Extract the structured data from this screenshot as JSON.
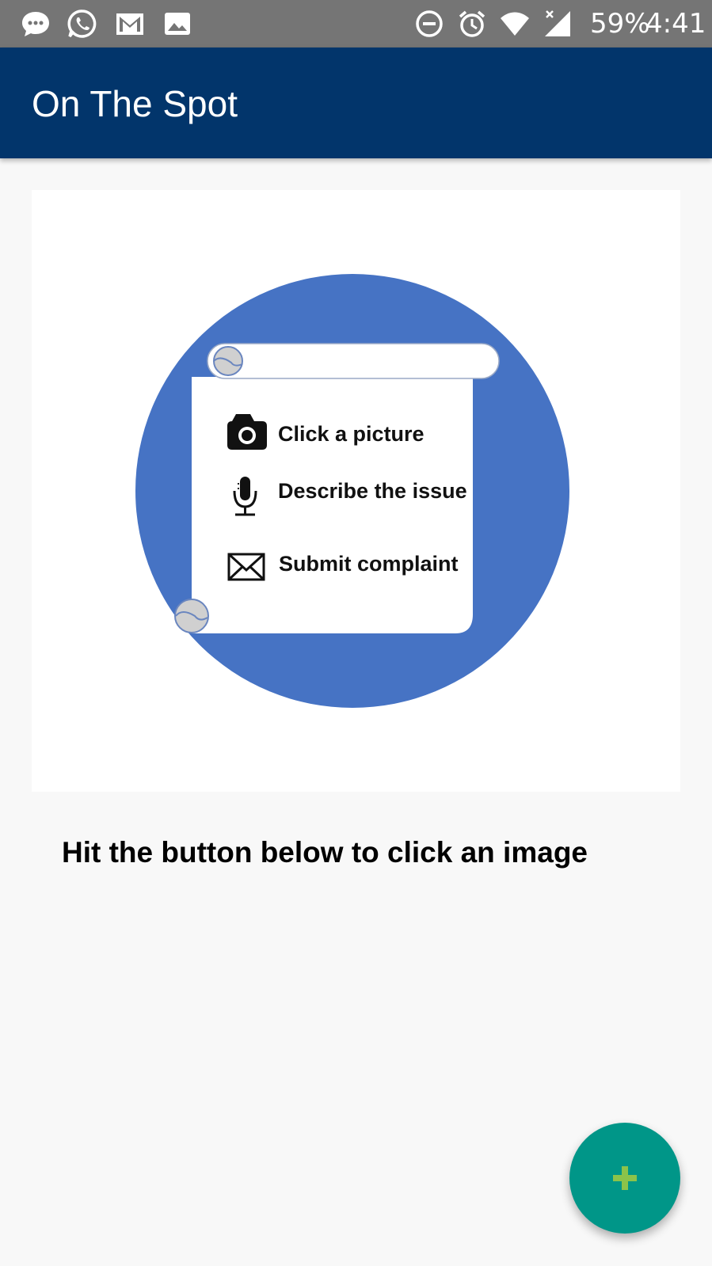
{
  "status_bar": {
    "left_icons": [
      "chat-bubble-icon",
      "whatsapp-icon",
      "gmail-icon",
      "image-icon"
    ],
    "right_icons": [
      "do-not-disturb-icon",
      "alarm-icon",
      "wifi-icon",
      "signal-icon"
    ],
    "battery_text": "59%",
    "time": "4:41"
  },
  "app_bar": {
    "title": "On The Spot",
    "color": "#02356b"
  },
  "hero": {
    "steps": [
      {
        "icon": "camera-icon",
        "label": "Click a picture"
      },
      {
        "icon": "microphone-icon",
        "label": "Describe the issue"
      },
      {
        "icon": "envelope-icon",
        "label": "Submit complaint"
      }
    ],
    "circle_color": "#4673c4"
  },
  "instruction": "Hit the button below to click an image",
  "fab": {
    "icon": "plus-icon",
    "color": "#009688",
    "icon_color": "#8bc34a"
  }
}
